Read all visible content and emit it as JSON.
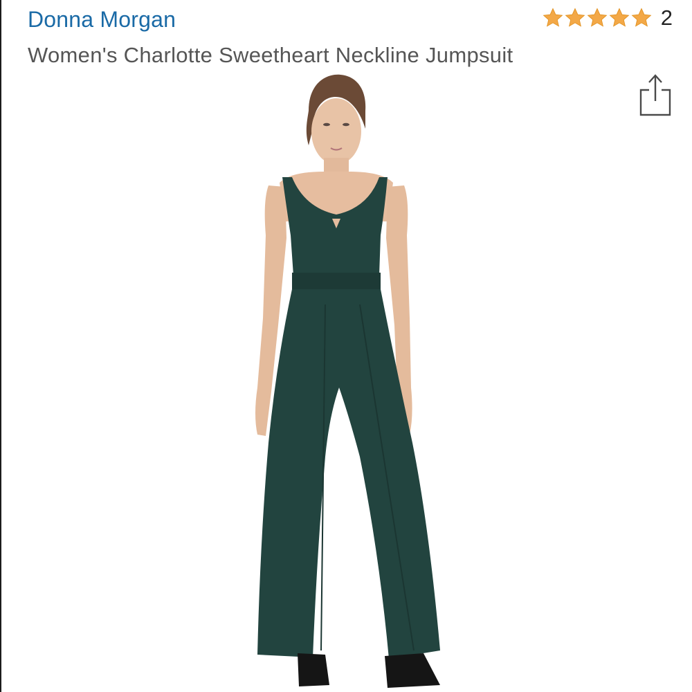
{
  "product": {
    "brand": "Donna Morgan",
    "title": "Women's Charlotte Sweetheart Neckline Jumpsuit",
    "rating": {
      "stars": 5,
      "max_stars": 5,
      "count": "2",
      "star_color": "#f3a847"
    },
    "share_icon": "share-icon",
    "image": {
      "garment_color": "#22443f"
    }
  }
}
